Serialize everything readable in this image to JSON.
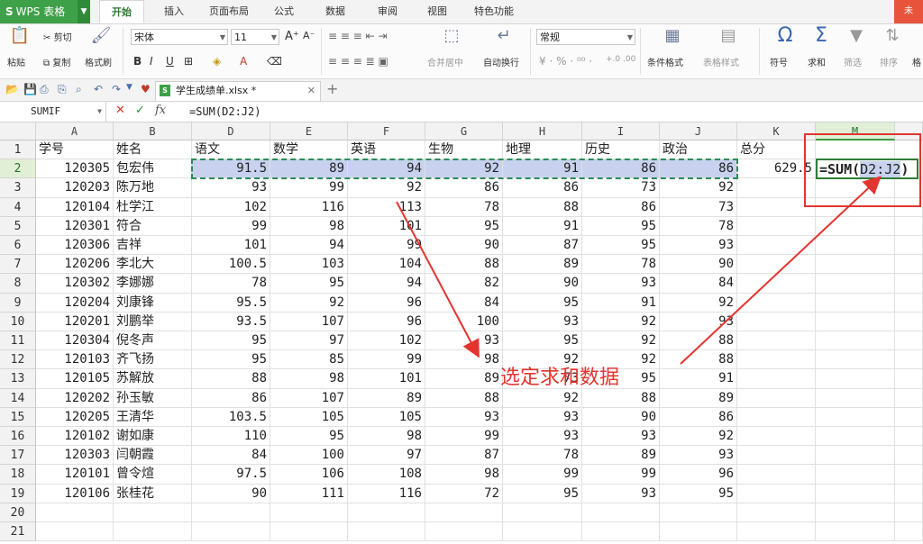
{
  "app": {
    "name": "WPS 表格"
  },
  "menu_tabs": [
    "开始",
    "插入",
    "页面布局",
    "公式",
    "数据",
    "审阅",
    "视图",
    "特色功能"
  ],
  "active_tab": "开始",
  "window_btn": "未",
  "ribbon": {
    "paste": "粘贴",
    "cut": "剪切",
    "copy": "复制",
    "format_painter": "格式刷",
    "font_name": "宋体",
    "font_size": "11",
    "merge_center": "合并居中",
    "auto_wrap": "自动换行",
    "number_format": "常规",
    "cond_format": "条件格式",
    "table_style": "表格样式",
    "symbol": "符号",
    "sum": "求和",
    "filter": "筛选",
    "sort": "排序",
    "format": "格"
  },
  "file_tab": {
    "name": "学生成绩单.xlsx *"
  },
  "formula_bar": {
    "name_box": "SUMIF",
    "formula": "=SUM(D2:J2)",
    "fx": "fx"
  },
  "columns": [
    "A",
    "B",
    "D",
    "E",
    "F",
    "G",
    "H",
    "I",
    "J",
    "K",
    "M"
  ],
  "headers": [
    "学号",
    "姓名",
    "语文",
    "数学",
    "英语",
    "生物",
    "地理",
    "历史",
    "政治",
    "总分"
  ],
  "rows": [
    {
      "id": "120305",
      "name": "包宏伟",
      "scores": [
        "91.5",
        "89",
        "94",
        "92",
        "91",
        "86",
        "86"
      ],
      "total": "629.5"
    },
    {
      "id": "120203",
      "name": "陈万地",
      "scores": [
        "93",
        "99",
        "92",
        "86",
        "86",
        "73",
        "92"
      ],
      "total": ""
    },
    {
      "id": "120104",
      "name": "杜学江",
      "scores": [
        "102",
        "116",
        "113",
        "78",
        "88",
        "86",
        "73"
      ],
      "total": ""
    },
    {
      "id": "120301",
      "name": "符合",
      "scores": [
        "99",
        "98",
        "101",
        "95",
        "91",
        "95",
        "78"
      ],
      "total": ""
    },
    {
      "id": "120306",
      "name": "吉祥",
      "scores": [
        "101",
        "94",
        "99",
        "90",
        "87",
        "95",
        "93"
      ],
      "total": ""
    },
    {
      "id": "120206",
      "name": "李北大",
      "scores": [
        "100.5",
        "103",
        "104",
        "88",
        "89",
        "78",
        "90"
      ],
      "total": ""
    },
    {
      "id": "120302",
      "name": "李娜娜",
      "scores": [
        "78",
        "95",
        "94",
        "82",
        "90",
        "93",
        "84"
      ],
      "total": ""
    },
    {
      "id": "120204",
      "name": "刘康锋",
      "scores": [
        "95.5",
        "92",
        "96",
        "84",
        "95",
        "91",
        "92"
      ],
      "total": ""
    },
    {
      "id": "120201",
      "name": "刘鹏举",
      "scores": [
        "93.5",
        "107",
        "96",
        "100",
        "93",
        "92",
        "93"
      ],
      "total": ""
    },
    {
      "id": "120304",
      "name": "倪冬声",
      "scores": [
        "95",
        "97",
        "102",
        "93",
        "95",
        "92",
        "88"
      ],
      "total": ""
    },
    {
      "id": "120103",
      "name": "齐飞扬",
      "scores": [
        "95",
        "85",
        "99",
        "98",
        "92",
        "92",
        "88"
      ],
      "total": ""
    },
    {
      "id": "120105",
      "name": "苏解放",
      "scores": [
        "88",
        "98",
        "101",
        "89",
        "73",
        "95",
        "91"
      ],
      "total": ""
    },
    {
      "id": "120202",
      "name": "孙玉敏",
      "scores": [
        "86",
        "107",
        "89",
        "88",
        "92",
        "88",
        "89"
      ],
      "total": ""
    },
    {
      "id": "120205",
      "name": "王清华",
      "scores": [
        "103.5",
        "105",
        "105",
        "93",
        "93",
        "90",
        "86"
      ],
      "total": ""
    },
    {
      "id": "120102",
      "name": "谢如康",
      "scores": [
        "110",
        "95",
        "98",
        "99",
        "93",
        "93",
        "92"
      ],
      "total": ""
    },
    {
      "id": "120303",
      "name": "闫朝霞",
      "scores": [
        "84",
        "100",
        "97",
        "87",
        "78",
        "89",
        "93"
      ],
      "total": ""
    },
    {
      "id": "120101",
      "name": "曾令煊",
      "scores": [
        "97.5",
        "106",
        "108",
        "98",
        "99",
        "99",
        "96"
      ],
      "total": ""
    },
    {
      "id": "120106",
      "name": "张桂花",
      "scores": [
        "90",
        "111",
        "116",
        "72",
        "95",
        "93",
        "95"
      ],
      "total": ""
    }
  ],
  "extra_row_numbers": [
    "20",
    "21"
  ],
  "editing_cell": {
    "prefix": "=SUM(",
    "ref": "D2:J2",
    "suffix": ")"
  },
  "annotation": "选定求和数据",
  "colors": {
    "accent": "#3ea049",
    "highlight": "#c8d2ef",
    "annotation": "#e3342f"
  }
}
